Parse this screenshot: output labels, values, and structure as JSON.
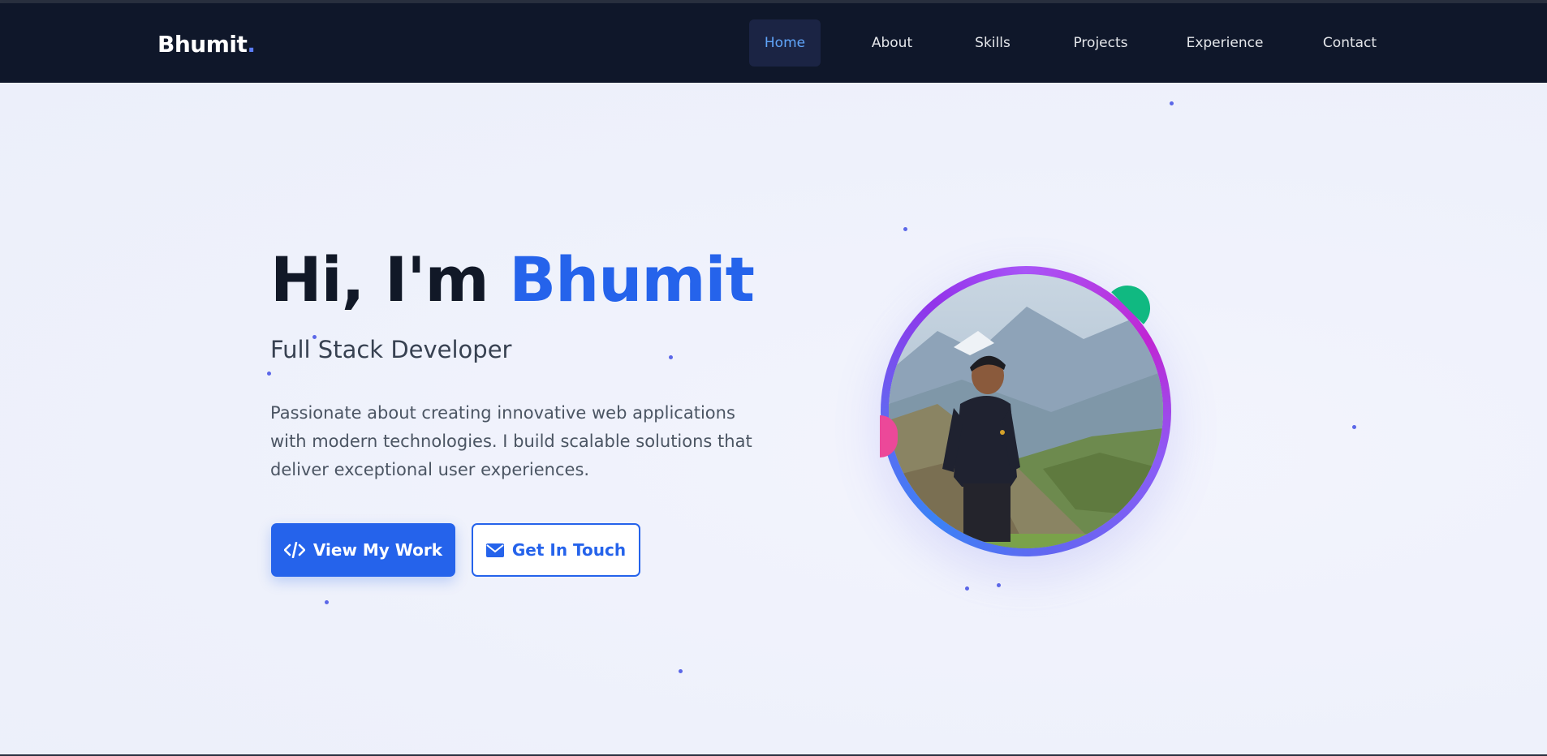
{
  "logo": {
    "text": "Bhumit",
    "dot": "."
  },
  "nav": {
    "items": [
      {
        "label": "Home",
        "active": true
      },
      {
        "label": "About"
      },
      {
        "label": "Skills"
      },
      {
        "label": "Projects"
      },
      {
        "label": "Experience"
      },
      {
        "label": "Contact"
      }
    ]
  },
  "hero": {
    "greeting": "Hi, I'm",
    "name": "Bhumit",
    "role": "Full Stack Developer",
    "description": "Passionate about creating innovative web applications with modern technologies. I build scalable solutions that deliver exceptional user experiences.",
    "primary_button": {
      "label": "View My Work",
      "icon": "code-icon"
    },
    "secondary_button": {
      "label": "Get In Touch",
      "icon": "envelope-icon"
    }
  },
  "colors": {
    "nav_bg": "#0f172a",
    "accent": "#2563eb",
    "nav_active_text": "#60a5fa",
    "page_bg": "#eef1fb",
    "particle": "#5b67e8"
  }
}
